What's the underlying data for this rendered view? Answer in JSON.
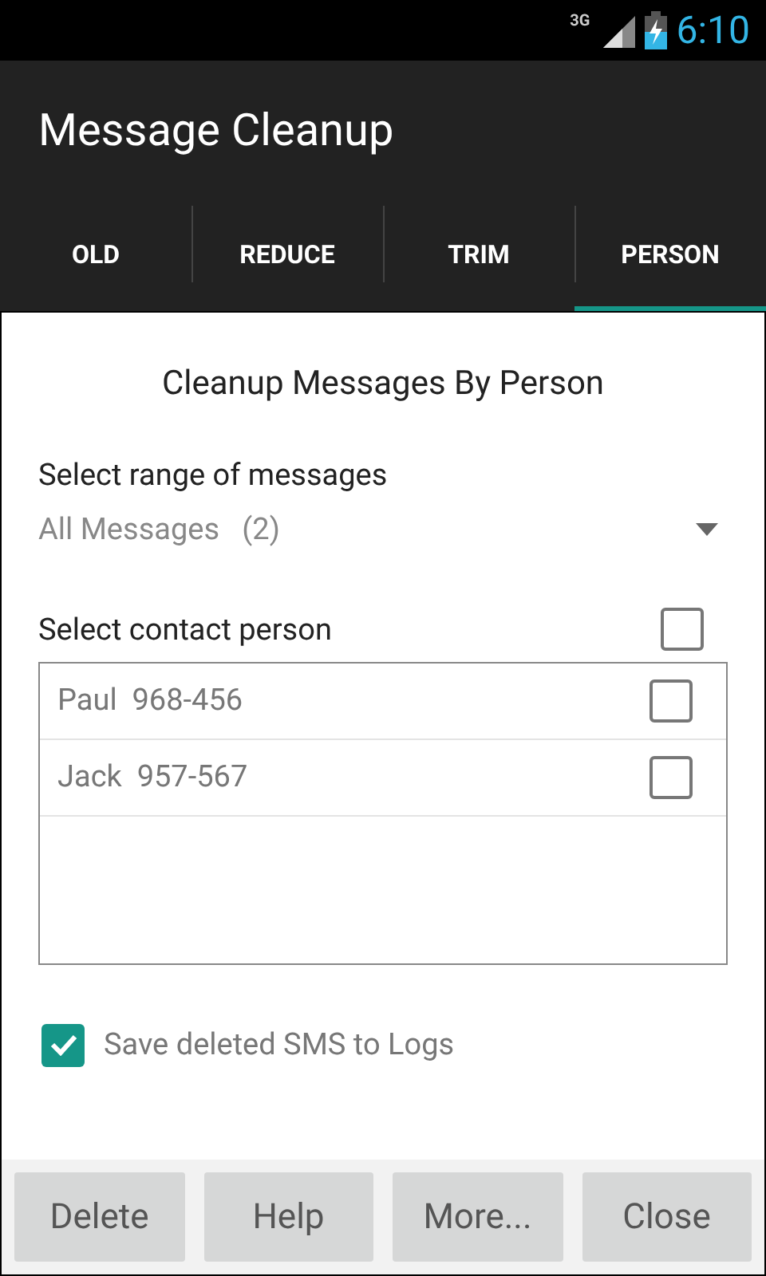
{
  "status_bar": {
    "network": "3G",
    "time": "6:10"
  },
  "app_bar": {
    "title": "Message Cleanup"
  },
  "tabs": [
    {
      "label": "OLD",
      "selected": false
    },
    {
      "label": "REDUCE",
      "selected": false
    },
    {
      "label": "TRIM",
      "selected": false
    },
    {
      "label": "PERSON",
      "selected": true
    }
  ],
  "heading": "Cleanup Messages By Person",
  "range": {
    "label": "Select range of messages",
    "value": "All Messages   (2)"
  },
  "contacts": {
    "label": "Select contact person",
    "all_checked": false,
    "items": [
      {
        "name": "Paul  968-456",
        "checked": false
      },
      {
        "name": "Jack  957-567",
        "checked": false
      }
    ]
  },
  "save_option": {
    "label": "Save deleted SMS to Logs",
    "checked": true
  },
  "buttons": [
    "Delete",
    "Help",
    "More...",
    "Close"
  ]
}
